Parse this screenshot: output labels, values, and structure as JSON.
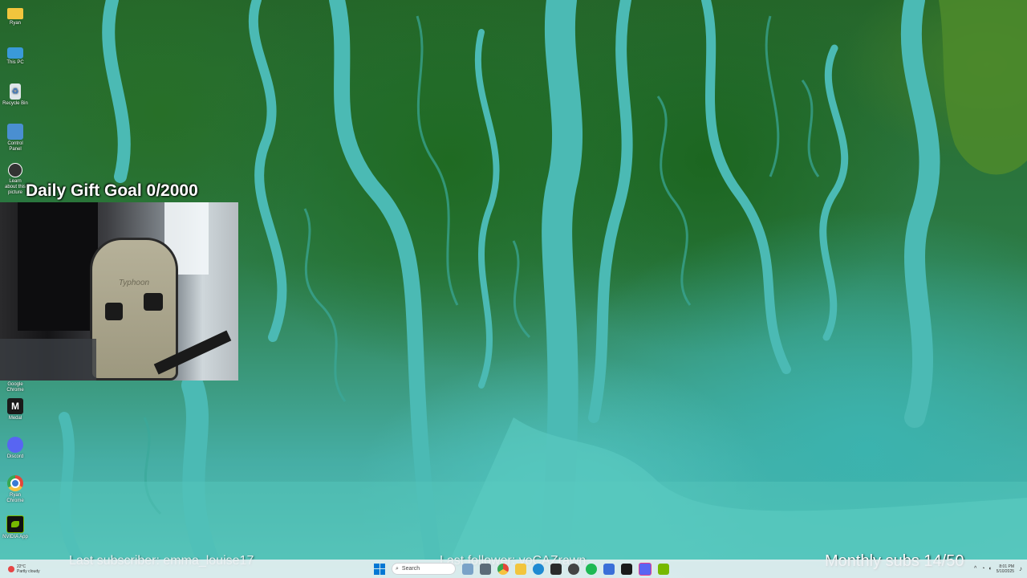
{
  "desktop_icons": [
    {
      "label": "Ryan",
      "icon": "folder-icon",
      "color": "#f2c53d"
    },
    {
      "label": "This PC",
      "icon": "monitor-icon",
      "color": "#3a9ad9"
    },
    {
      "label": "Recycle Bin",
      "icon": "recycle-bin-icon",
      "color": "#dfe6ea"
    },
    {
      "label": "Control Panel",
      "icon": "control-panel-icon",
      "color": "#4a8fd1"
    },
    {
      "label": "Learn about this picture",
      "icon": "camera-icon",
      "color": "#333333"
    },
    {
      "label": "Google Chrome",
      "icon": "chrome-icon",
      "color": "#e5473a"
    },
    {
      "label": "Medal",
      "icon": "medal-icon",
      "color": "#1a1a1a"
    },
    {
      "label": "Discord",
      "icon": "discord-icon",
      "color": "#5865f2"
    },
    {
      "label": "Ryan Chrome",
      "icon": "chrome-icon",
      "color": "#e5473a"
    },
    {
      "label": "NVIDIA App",
      "icon": "nvidia-icon",
      "color": "#76b900"
    }
  ],
  "overlay": {
    "gift_goal": "Daily Gift Goal 0/2000",
    "last_subscriber": "Last subscriber: emma_louise17",
    "last_follower": "Last follower: yoCAZrawn",
    "monthly_subs": "Monthly subs 14/50"
  },
  "webcam": {
    "chair_brand": "Typhoon"
  },
  "taskbar": {
    "weather_temp": "22°C",
    "weather_desc": "Partly cloudy",
    "search_placeholder": "Search",
    "time": "8:01 PM",
    "date": "5/10/2025",
    "accent": "#0078d4"
  }
}
